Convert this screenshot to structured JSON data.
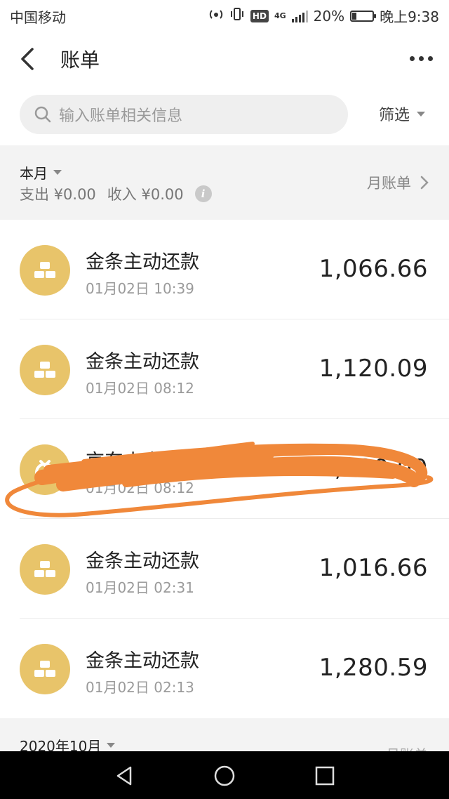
{
  "status_bar": {
    "carrier": "中国移动",
    "hd": "HD",
    "network": "4G",
    "battery_pct": "20%",
    "battery_level": 0.2,
    "time": "晚上9:38"
  },
  "header": {
    "title": "账单",
    "back_icon": "back-arrow-icon",
    "more_icon": "more-dots-icon"
  },
  "search": {
    "placeholder": "输入账单相关信息",
    "filter_label": "筛选"
  },
  "month": {
    "label": "本月",
    "expense": "支出 ¥0.00",
    "income": "收入 ¥0.00",
    "bill_link": "月账单"
  },
  "transactions": [
    {
      "name": "金条主动还款",
      "time": "01月02日 10:39",
      "amount": "1,066.66",
      "icon": "gold-bars-icon"
    },
    {
      "name": "金条主动还款",
      "time": "01月02日 08:12",
      "amount": "1,120.09",
      "icon": "gold-bars-icon"
    },
    {
      "name": "京东小金库",
      "time": "01月02日 08:12",
      "amount": "1,120.09",
      "icon": "coin-bag-icon"
    },
    {
      "name": "金条主动还款",
      "time": "01月02日 02:31",
      "amount": "1,016.66",
      "icon": "gold-bars-icon"
    },
    {
      "name": "金条主动还款",
      "time": "01月02日 02:13",
      "amount": "1,280.59",
      "icon": "gold-bars-icon"
    }
  ],
  "next_month": {
    "label": "2020年10月",
    "bill_link": "月账单"
  },
  "colors": {
    "accent_gold": "#e8c46a",
    "scribble": "#f0883a",
    "text_primary": "#222222",
    "text_secondary": "#9a9a9a"
  }
}
